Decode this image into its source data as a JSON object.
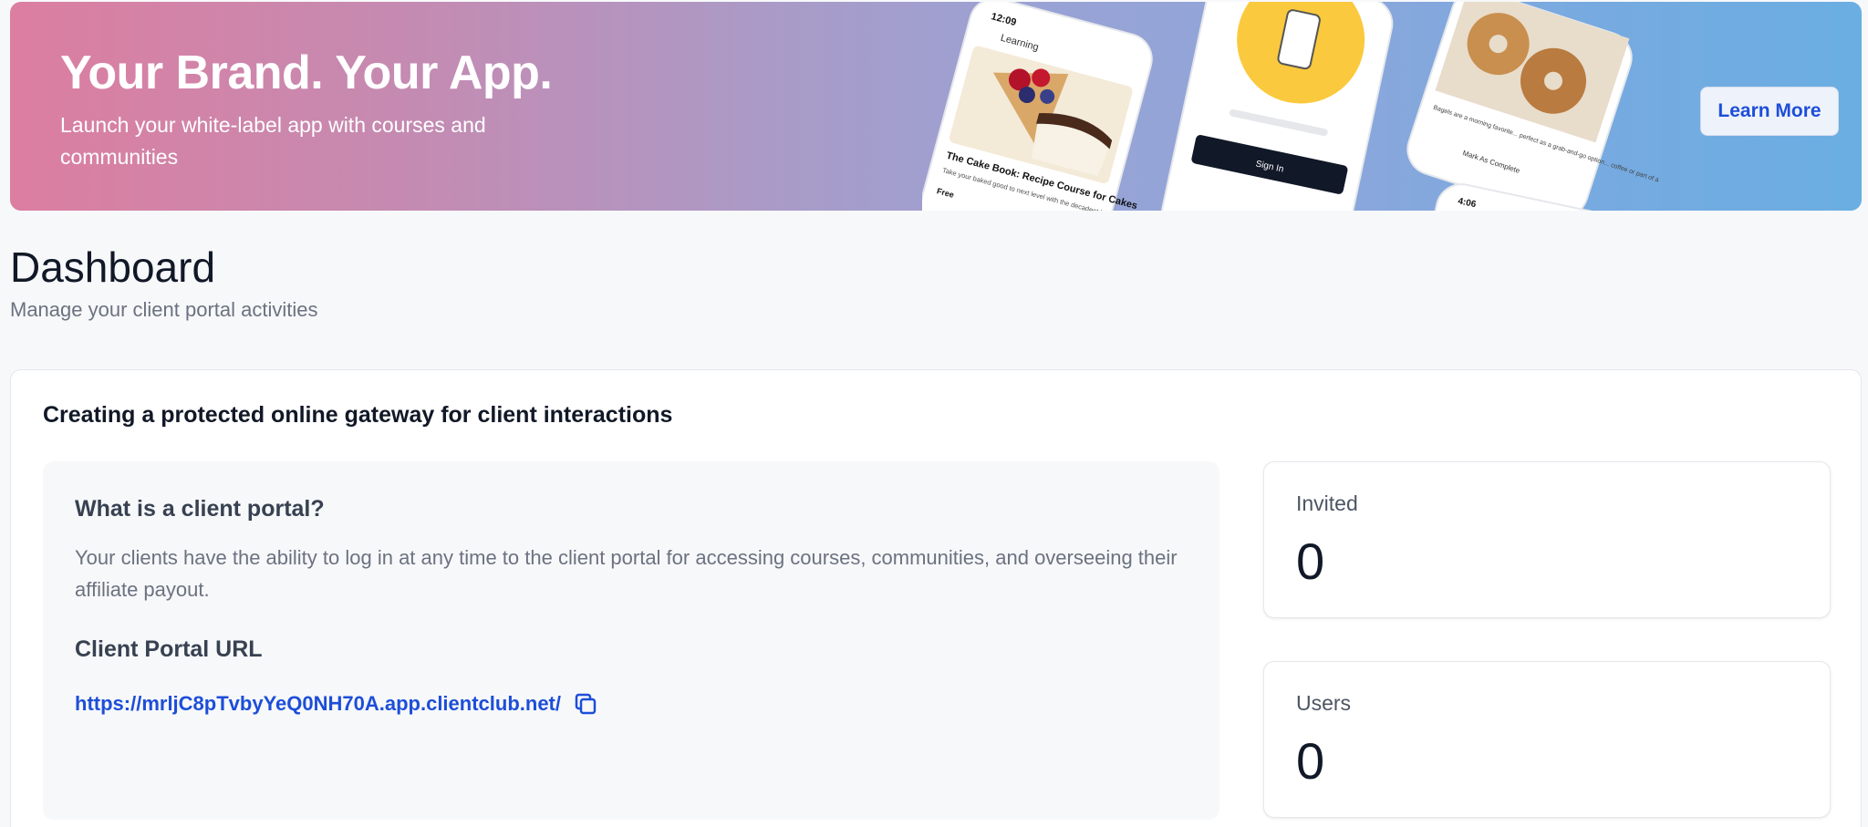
{
  "banner": {
    "title": "Your Brand. Your App.",
    "subtitle": "Launch your white-label app with courses and communities",
    "cta_label": "Learn More",
    "phone1": {
      "time": "12:09",
      "header": "Learning",
      "course_title": "The Cake Book: Recipe Course for Cakes",
      "course_desc": "Take your baked good to next level with the decadent buttercreams, meringues, ganache and more.",
      "price": "Free"
    },
    "phone2": {
      "button": "Sign In"
    },
    "phone3": {
      "text": "Bagels are a morning favorite... perfect as a grab-and-go option... coffee or part of a",
      "mark_complete": "Mark As Complete"
    },
    "phone4": {
      "time": "4:06"
    }
  },
  "page": {
    "title": "Dashboard",
    "subtitle": "Manage your client portal activities"
  },
  "card": {
    "title": "Creating a protected online gateway for client interactions",
    "info_heading": "What is a client portal?",
    "info_text": "Your clients have the ability to log in at any time to the client portal for accessing courses, communities, and overseeing their affiliate payout.",
    "url_heading": "Client Portal URL",
    "url": "https://mrljC8pTvbyYeQ0NH70A.app.clientclub.net/"
  },
  "stats": {
    "invited_label": "Invited",
    "invited_value": "0",
    "users_label": "Users",
    "users_value": "0"
  },
  "colors": {
    "accent": "#1d4ed8",
    "banner_start": "#dc7ea0",
    "banner_end": "#6aaee2"
  }
}
